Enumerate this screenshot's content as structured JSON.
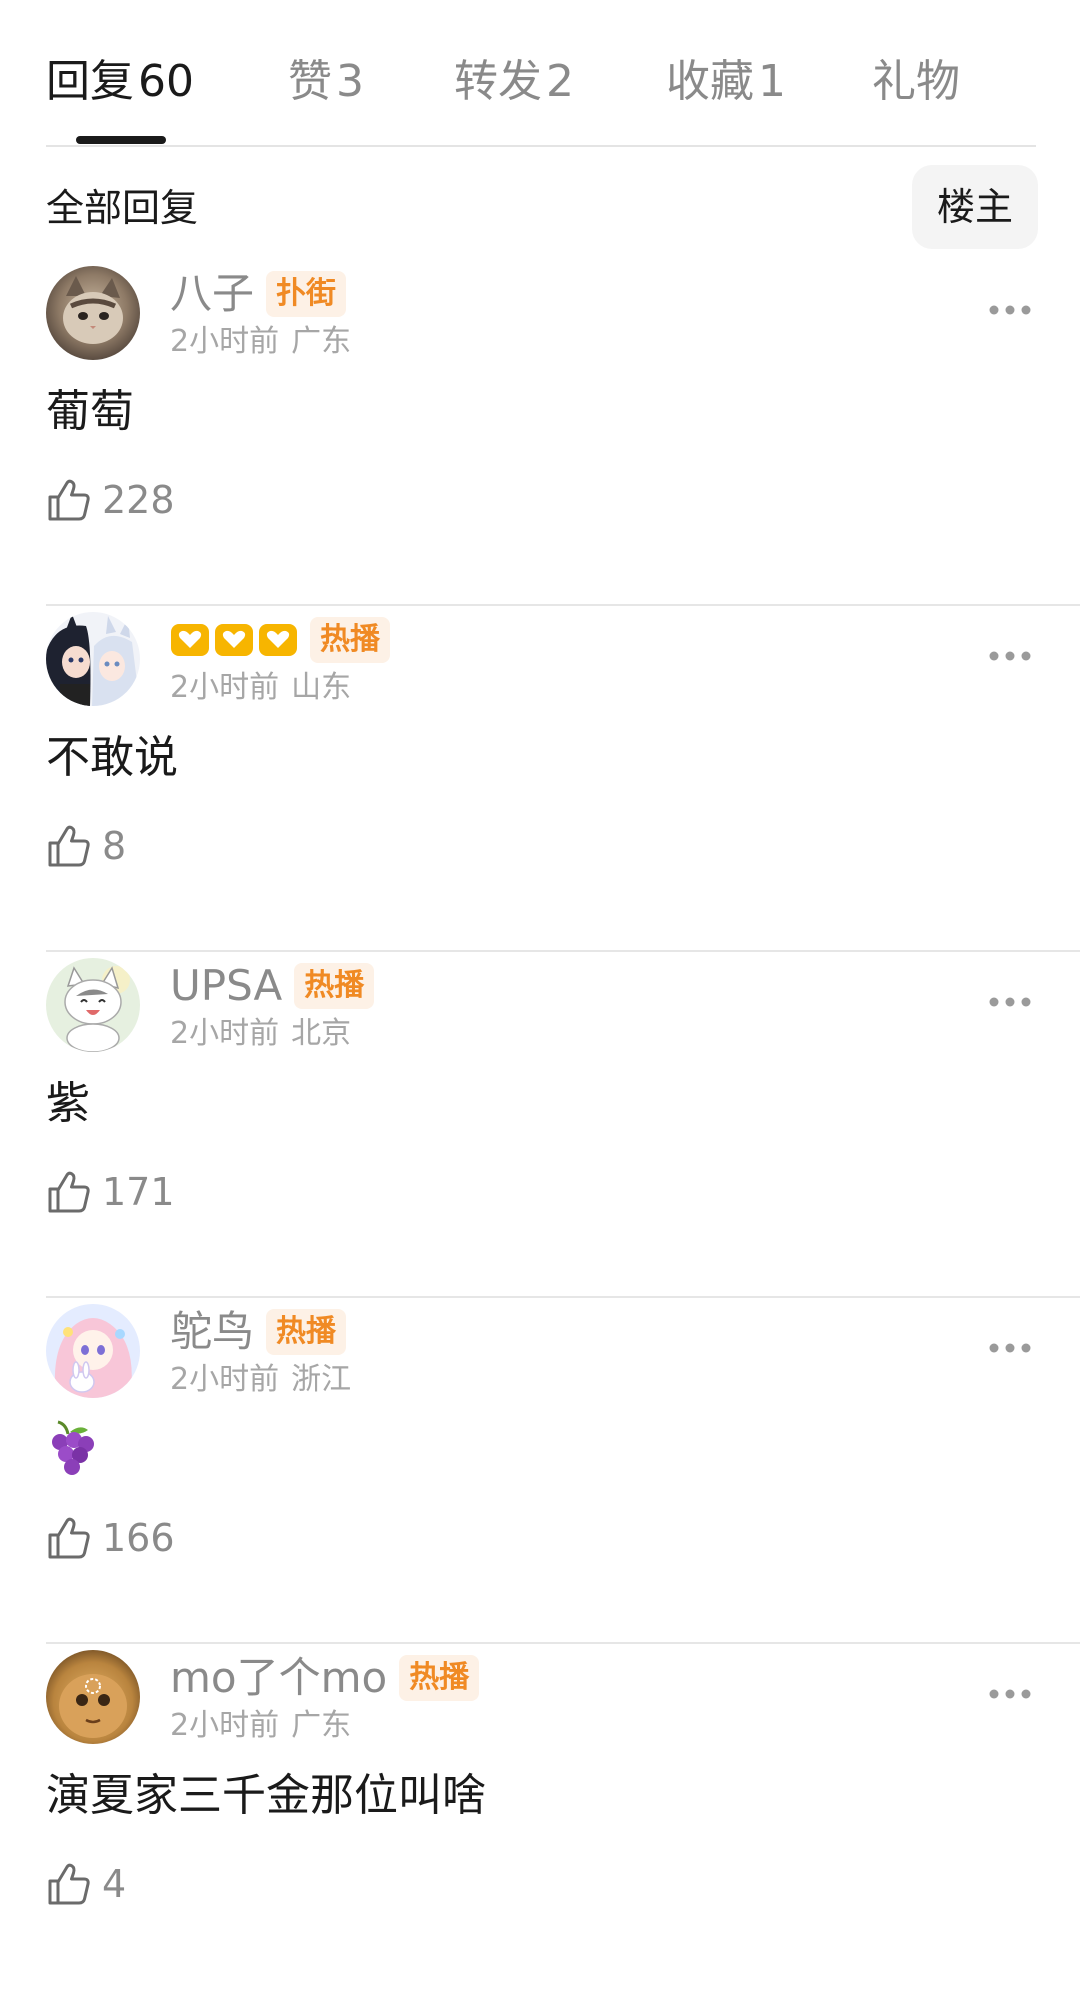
{
  "tabs": [
    {
      "label": "回复",
      "count": "60"
    },
    {
      "label": "赞",
      "count": "3"
    },
    {
      "label": "转发",
      "count": "2"
    },
    {
      "label": "收藏",
      "count": "1"
    },
    {
      "label": "礼物",
      "count": ""
    }
  ],
  "section": {
    "title": "全部回复",
    "filter_label": "楼主"
  },
  "comments": [
    {
      "username": "八子",
      "badge": "扑街",
      "time": "2小时前",
      "location": "广东",
      "content": "葡萄",
      "likes": "228",
      "avatar": "cat-photo-icon"
    },
    {
      "username": "",
      "name_icons": "three-heart-hands-icons",
      "badge": "热播",
      "time": "2小时前",
      "location": "山东",
      "content": "不敢说",
      "likes": "8",
      "avatar": "anime-couple-icon"
    },
    {
      "username": "UPSA",
      "badge": "热播",
      "time": "2小时前",
      "location": "北京",
      "content": "紫",
      "likes": "171",
      "avatar": "cartoon-cat-icon"
    },
    {
      "username": "鸵鸟",
      "badge": "热播",
      "time": "2小时前",
      "location": "浙江",
      "content": "🍇",
      "likes": "166",
      "avatar": "anime-girl-bunny-icon"
    },
    {
      "username": "mo了个mo",
      "badge": "热播",
      "time": "2小时前",
      "location": "广东",
      "content": "演夏家三千金那位叫啥",
      "likes": "4",
      "avatar": "loading-face-icon"
    }
  ],
  "colors": {
    "badge_text": "#f08a24",
    "badge_bg": "#fdf1e6",
    "heart_gold": "#f7b500"
  }
}
